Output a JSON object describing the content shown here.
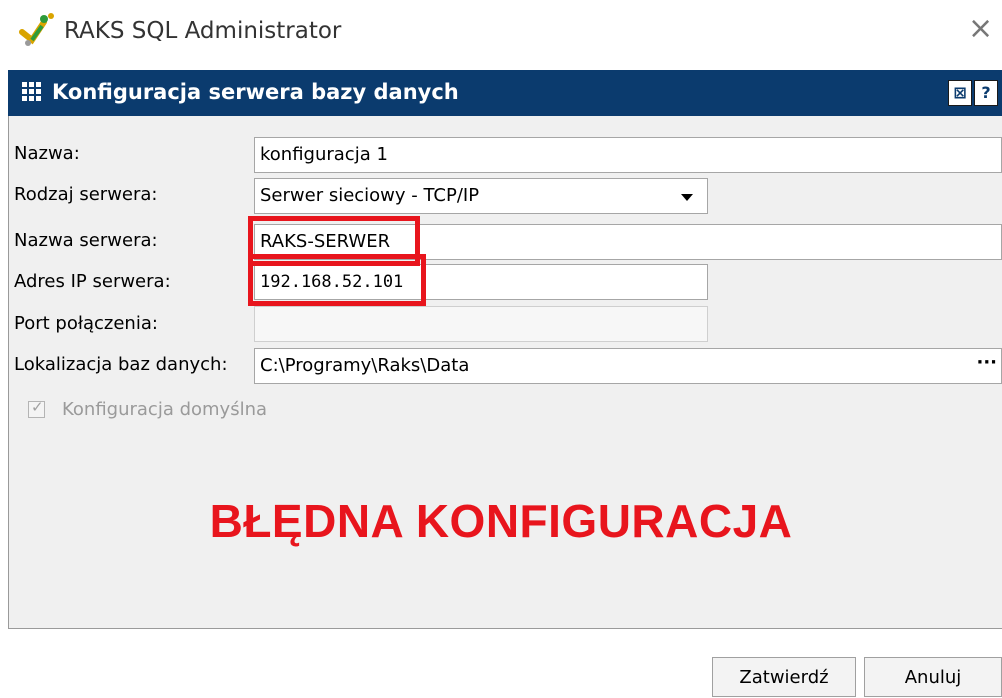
{
  "window": {
    "title": "RAKS SQL Administrator",
    "close_glyph": "×"
  },
  "panel": {
    "title": "Konfiguracja serwera bazy danych",
    "header_buttons": [
      "⊠",
      "?"
    ]
  },
  "form": {
    "name_label": "Nazwa:",
    "name_value": "konfiguracja 1",
    "server_type_label": "Rodzaj serwera:",
    "server_type_value": "Serwer sieciowy - TCP/IP",
    "server_name_label": "Nazwa serwera:",
    "server_name_value": "RAKS-SERWER",
    "server_ip_label": "Adres IP serwera:",
    "server_ip_value": "192.168.52.101",
    "port_label": "Port połączenia:",
    "port_value": "",
    "db_location_label": "Lokalizacja baz danych:",
    "db_location_value": "C:\\Programy\\Raks\\Data",
    "browse_glyph": "···",
    "default_config_label": "Konfiguracja domyślna",
    "default_config_checked": true
  },
  "annotation": {
    "text": "BŁĘDNA KONFIGURACJA",
    "color": "#e8151d"
  },
  "buttons": {
    "confirm": "Zatwierdź",
    "cancel": "Anuluj"
  },
  "colors": {
    "header_bg": "#0b3b6e",
    "panel_bg": "#f0f0f0",
    "highlight": "#e8151d"
  }
}
